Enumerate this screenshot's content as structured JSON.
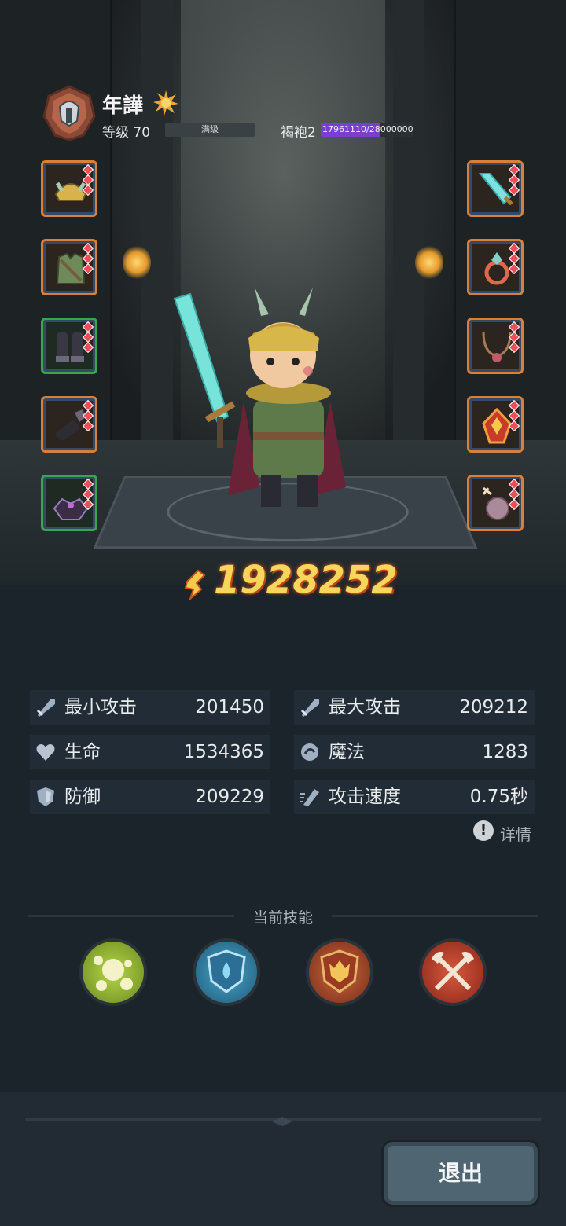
{
  "header": {
    "hero_name": "年譁",
    "level_label": "等级 70",
    "level_status": "满级",
    "robe_label": "褐袍2",
    "robe_progress": "17961110/28000000",
    "robe_progress_fraction": 0.641
  },
  "equipment": {
    "left": [
      {
        "name": "helmet",
        "rarity": "orange"
      },
      {
        "name": "armor",
        "rarity": "orange"
      },
      {
        "name": "boots",
        "rarity": "green"
      },
      {
        "name": "gloves",
        "rarity": "orange"
      },
      {
        "name": "shoulders",
        "rarity": "green"
      }
    ],
    "right": [
      {
        "name": "sword",
        "rarity": "orange"
      },
      {
        "name": "ring",
        "rarity": "orange"
      },
      {
        "name": "necklace",
        "rarity": "orange"
      },
      {
        "name": "talisman",
        "rarity": "orange"
      },
      {
        "name": "pendant",
        "rarity": "orange"
      }
    ]
  },
  "combat_power": "1928252",
  "stats": {
    "min_attack": {
      "label": "最小攻击",
      "value": "201450"
    },
    "max_attack": {
      "label": "最大攻击",
      "value": "209212"
    },
    "hp": {
      "label": "生命",
      "value": "1534365"
    },
    "mp": {
      "label": "魔法",
      "value": "1283"
    },
    "defense": {
      "label": "防御",
      "value": "209229"
    },
    "attack_speed": {
      "label": "攻击速度",
      "value": "0.75秒"
    }
  },
  "details_label": "详情",
  "skills": {
    "title": "当前技能",
    "items": [
      {
        "icon": "bubbles-icon",
        "color": "#9bbf2e"
      },
      {
        "icon": "water-shield-icon",
        "color": "#2f7ca6"
      },
      {
        "icon": "fire-shield-icon",
        "color": "#b8552c"
      },
      {
        "icon": "crossed-axes-icon",
        "color": "#c2412f"
      }
    ]
  },
  "exit_label": "退出",
  "colors": {
    "power": "#f6d65b",
    "robe_bar": "#7a3fcf",
    "slot_orange": "#d8803a",
    "slot_green": "#3aa44f"
  }
}
